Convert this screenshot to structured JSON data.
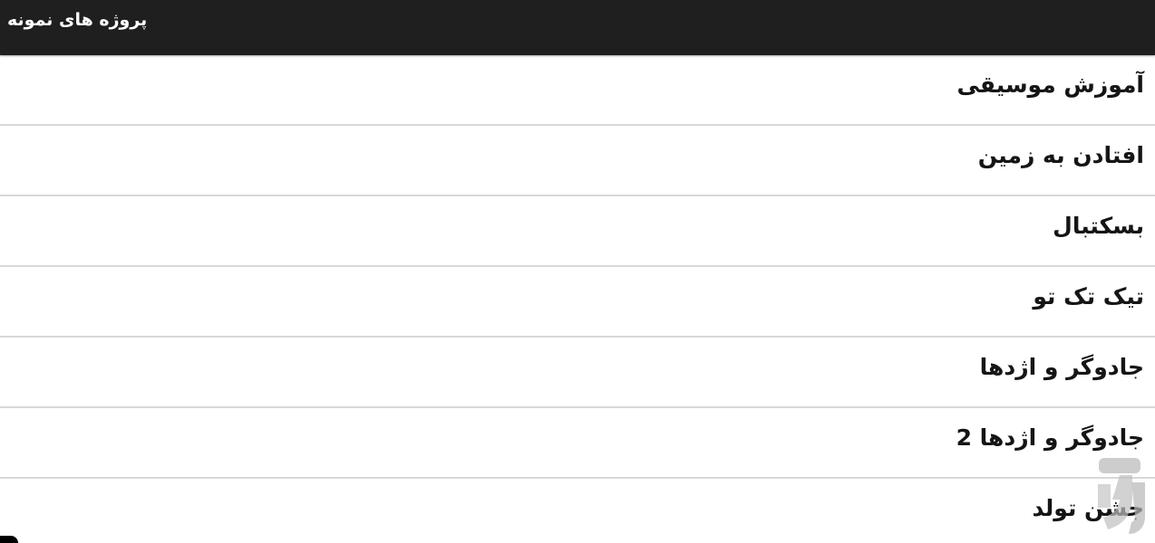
{
  "app": {
    "title": "پروژه های نمونه",
    "colors": {
      "titlebar": "#1f1f1f",
      "title_text": "#ffffff",
      "list_background": "#ffffff",
      "row_text": "#151515",
      "divider": "#d8d8d8"
    }
  },
  "items": [
    "آموزش موسیقی",
    "افتادن به زمین",
    "بسکتبال",
    "تیک تک تو",
    "جادوگر و اژدها",
    "جادوگر و اژدها 2",
    "جشن تولد"
  ]
}
